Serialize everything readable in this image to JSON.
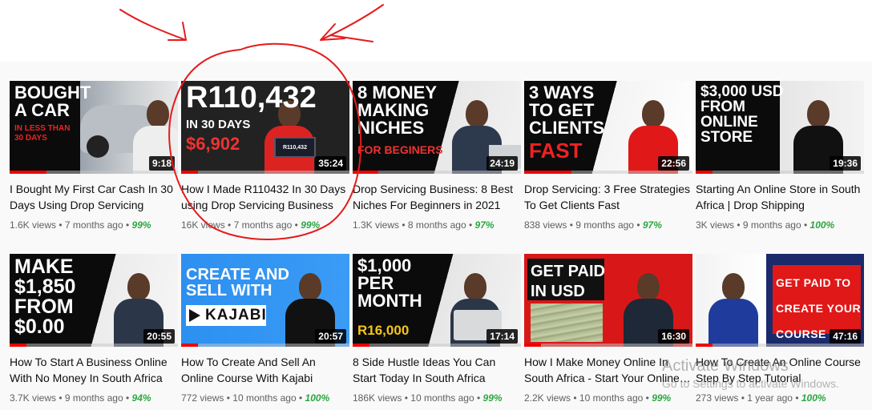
{
  "videos": [
    {
      "headline": "BOUGHT\nA CAR",
      "subline": "IN LESS THAN\n30 DAYS",
      "duration": "9:18",
      "title": "I Bought My First Car Cash In 30 Days Using Drop Servicing",
      "views": "1.6K views",
      "age": "7 months ago",
      "rating": "99%",
      "progress": 0.22
    },
    {
      "headline": "R110,432",
      "subline": "IN 30 DAYS",
      "subline2": "$6,902",
      "laptop_text": "R110,432",
      "duration": "35:24",
      "title": "How I Made R110432 In 30 Days using Drop Servicing Business",
      "views": "16K views",
      "age": "7 months ago",
      "rating": "99%",
      "progress": 0.1
    },
    {
      "headline": "8 MONEY\nMAKING\nNICHES",
      "subline": "FOR BEGINERS",
      "duration": "24:19",
      "title": "Drop Servicing Business: 8 Best Niches For Beginners in 2021",
      "views": "1.3K views",
      "age": "8 months ago",
      "rating": "97%",
      "progress": 0.15
    },
    {
      "headline": "3 WAYS\nTO GET\nCLIENTS",
      "subline": "FAST",
      "duration": "22:56",
      "title": "Drop Servicing: 3 Free Strategies To Get Clients Fast",
      "views": "838 views",
      "age": "9 months ago",
      "rating": "97%",
      "progress": 0.28
    },
    {
      "headline": "$3,000 USD\nFROM\nONLINE\nSTORE",
      "duration": "19:36",
      "title": "Starting An Online Store in South Africa | Drop Shipping",
      "views": "3K views",
      "age": "9 months ago",
      "rating": "100%",
      "progress": 0.1
    },
    {
      "headline": "MAKE\n$1,850\nFROM\n$0.00",
      "duration": "20:55",
      "title": "How To Start A Business Online With No Money In South Africa",
      "views": "3.7K views",
      "age": "9 months ago",
      "rating": "94%",
      "progress": 0.1
    },
    {
      "headline": "CREATE AND\nSELL WITH",
      "subline": "KAJABI",
      "duration": "20:57",
      "title": "How To Create And Sell An Online Course With Kajabi",
      "views": "772 views",
      "age": "10 months ago",
      "rating": "100%",
      "progress": 0.1
    },
    {
      "headline": "$1,000\nPER\nMONTH",
      "subline": "R16,000",
      "duration": "17:14",
      "title": "8 Side Hustle Ideas You Can Start Today In South Africa",
      "views": "186K views",
      "age": "10 months ago",
      "rating": "99%",
      "progress": 0.1
    },
    {
      "headline": "GET PAID\nIN USD",
      "duration": "16:30",
      "title": "How I Make Money Online In South Africa - Start Your Online Business",
      "views": "2.2K views",
      "age": "10 months ago",
      "rating": "99%",
      "progress": 0.1
    },
    {
      "headline": "GET PAID TO\nCREATE YOUR\nCOURSE",
      "duration": "47:16",
      "title": "How To Create An Online Course Step By Step Tutorial",
      "views": "273 views",
      "age": "1 year ago",
      "rating": "100%",
      "progress": 0.1
    }
  ],
  "meta_separator": "•",
  "watermark": {
    "line1": "Activate Windows",
    "line2": "Go to Settings to activate Windows."
  },
  "colors": {
    "accent_red": "#e00000",
    "rating_green": "#2ba640",
    "meta_grey": "#606060",
    "annotation_red": "#e51b1b"
  }
}
